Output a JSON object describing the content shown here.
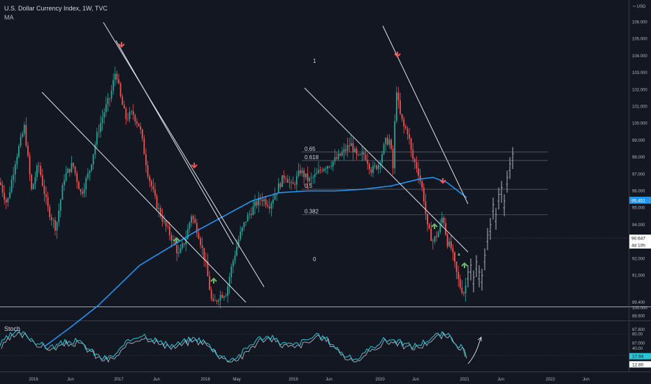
{
  "header": {
    "title": "U.S. Dollar Currency Index, 1W, TVC",
    "indicator": "MA"
  },
  "price_axis": {
    "currency": "USD",
    "ticks": [
      "106.000",
      "105.000",
      "104.000",
      "103.000",
      "102.000",
      "101.000",
      "100.000",
      "99.000",
      "98.000",
      "97.000",
      "96.000",
      "95.000",
      "94.000",
      "93.000",
      "92.000",
      "91.000",
      "89.400",
      "88.600",
      "87.800",
      "87.000",
      "100.000"
    ],
    "ma_tag": "95.451",
    "price_tag": "90.647",
    "countdown_tag": "4d 10h"
  },
  "fib_levels": [
    {
      "label": "0.65",
      "price": 98.3
    },
    {
      "label": "0.618",
      "price": 97.8
    },
    {
      "label": "0.5",
      "price": 96.1
    },
    {
      "label": "0.382",
      "price": 94.6
    }
  ],
  "stoch": {
    "label": "Stoch",
    "ticks": [
      "80.00",
      "40.00"
    ],
    "k_tag": "17.94",
    "d_tag": "12.80"
  },
  "time_axis": [
    "2016",
    "Jun",
    "2017",
    "Jun",
    "2018",
    "May",
    "2019",
    "Jun",
    "2020",
    "Jun",
    "2021",
    "Jun",
    "2022",
    "Jun"
  ],
  "colors": {
    "background": "#131722",
    "up": "#26a69a",
    "down": "#ef5350",
    "ma": "#2196f3",
    "projection": "#b2b5be",
    "trendline": "#e0e3eb",
    "arrow_up": "#66bb6a",
    "arrow_down": "#ef5350",
    "stoch_k": "#26c6da",
    "stoch_d": "#b2b5be"
  }
}
